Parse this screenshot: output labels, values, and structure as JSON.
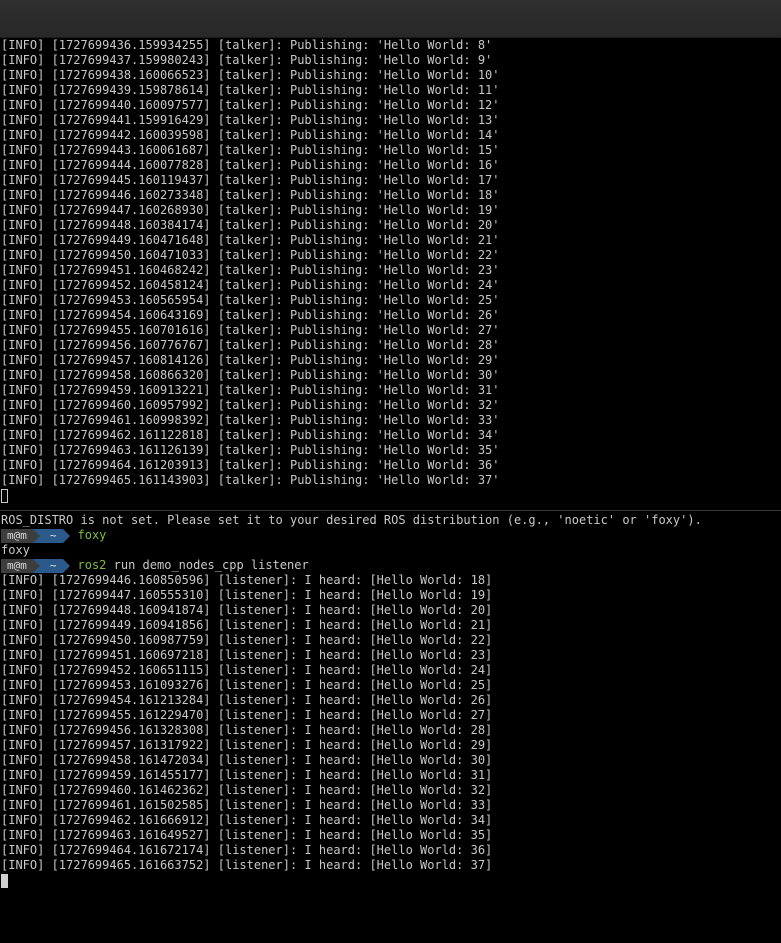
{
  "window": {
    "title": ""
  },
  "top_pane": {
    "lines": [
      "[INFO] [1727699436.159934255] [talker]: Publishing: 'Hello World: 8'",
      "[INFO] [1727699437.159980243] [talker]: Publishing: 'Hello World: 9'",
      "[INFO] [1727699438.160066523] [talker]: Publishing: 'Hello World: 10'",
      "[INFO] [1727699439.159878614] [talker]: Publishing: 'Hello World: 11'",
      "[INFO] [1727699440.160097577] [talker]: Publishing: 'Hello World: 12'",
      "[INFO] [1727699441.159916429] [talker]: Publishing: 'Hello World: 13'",
      "[INFO] [1727699442.160039598] [talker]: Publishing: 'Hello World: 14'",
      "[INFO] [1727699443.160061687] [talker]: Publishing: 'Hello World: 15'",
      "[INFO] [1727699444.160077828] [talker]: Publishing: 'Hello World: 16'",
      "[INFO] [1727699445.160119437] [talker]: Publishing: 'Hello World: 17'",
      "[INFO] [1727699446.160273348] [talker]: Publishing: 'Hello World: 18'",
      "[INFO] [1727699447.160268930] [talker]: Publishing: 'Hello World: 19'",
      "[INFO] [1727699448.160384174] [talker]: Publishing: 'Hello World: 20'",
      "[INFO] [1727699449.160471648] [talker]: Publishing: 'Hello World: 21'",
      "[INFO] [1727699450.160471033] [talker]: Publishing: 'Hello World: 22'",
      "[INFO] [1727699451.160468242] [talker]: Publishing: 'Hello World: 23'",
      "[INFO] [1727699452.160458124] [talker]: Publishing: 'Hello World: 24'",
      "[INFO] [1727699453.160565954] [talker]: Publishing: 'Hello World: 25'",
      "[INFO] [1727699454.160643169] [talker]: Publishing: 'Hello World: 26'",
      "[INFO] [1727699455.160701616] [talker]: Publishing: 'Hello World: 27'",
      "[INFO] [1727699456.160776767] [talker]: Publishing: 'Hello World: 28'",
      "[INFO] [1727699457.160814126] [talker]: Publishing: 'Hello World: 29'",
      "[INFO] [1727699458.160866320] [talker]: Publishing: 'Hello World: 30'",
      "[INFO] [1727699459.160913221] [talker]: Publishing: 'Hello World: 31'",
      "[INFO] [1727699460.160957992] [talker]: Publishing: 'Hello World: 32'",
      "[INFO] [1727699461.160998392] [talker]: Publishing: 'Hello World: 33'",
      "[INFO] [1727699462.161122818] [talker]: Publishing: 'Hello World: 34'",
      "[INFO] [1727699463.161126139] [talker]: Publishing: 'Hello World: 35'",
      "[INFO] [1727699464.161203913] [talker]: Publishing: 'Hello World: 36'",
      "[INFO] [1727699465.161143903] [talker]: Publishing: 'Hello World: 37'"
    ]
  },
  "bottom_pane": {
    "warning": "ROS_DISTRO is not set. Please set it to your desired ROS distribution (e.g., 'noetic' or 'foxy').",
    "prompt_user": "m@m",
    "prompt_dir": "~",
    "cmd1_name": "foxy",
    "cmd1_output": "foxy",
    "cmd2_name": "ros2",
    "cmd2_args": " run demo_nodes_cpp listener",
    "lines": [
      "[INFO] [1727699446.160850596] [listener]: I heard: [Hello World: 18]",
      "[INFO] [1727699447.160555310] [listener]: I heard: [Hello World: 19]",
      "[INFO] [1727699448.160941874] [listener]: I heard: [Hello World: 20]",
      "[INFO] [1727699449.160941856] [listener]: I heard: [Hello World: 21]",
      "[INFO] [1727699450.160987759] [listener]: I heard: [Hello World: 22]",
      "[INFO] [1727699451.160697218] [listener]: I heard: [Hello World: 23]",
      "[INFO] [1727699452.160651115] [listener]: I heard: [Hello World: 24]",
      "[INFO] [1727699453.161093276] [listener]: I heard: [Hello World: 25]",
      "[INFO] [1727699454.161213284] [listener]: I heard: [Hello World: 26]",
      "[INFO] [1727699455.161229470] [listener]: I heard: [Hello World: 27]",
      "[INFO] [1727699456.161328308] [listener]: I heard: [Hello World: 28]",
      "[INFO] [1727699457.161317922] [listener]: I heard: [Hello World: 29]",
      "[INFO] [1727699458.161472034] [listener]: I heard: [Hello World: 30]",
      "[INFO] [1727699459.161455177] [listener]: I heard: [Hello World: 31]",
      "[INFO] [1727699460.161462362] [listener]: I heard: [Hello World: 32]",
      "[INFO] [1727699461.161502585] [listener]: I heard: [Hello World: 33]",
      "[INFO] [1727699462.161666912] [listener]: I heard: [Hello World: 34]",
      "[INFO] [1727699463.161649527] [listener]: I heard: [Hello World: 35]",
      "[INFO] [1727699464.161672174] [listener]: I heard: [Hello World: 36]",
      "[INFO] [1727699465.161663752] [listener]: I heard: [Hello World: 37]"
    ]
  },
  "colors": {
    "background": "#000000",
    "text": "#c8c8c8",
    "command": "#7bbf3b",
    "prompt_user_bg": "#3d3d3d",
    "prompt_dir_bg": "#2b5a8a"
  }
}
